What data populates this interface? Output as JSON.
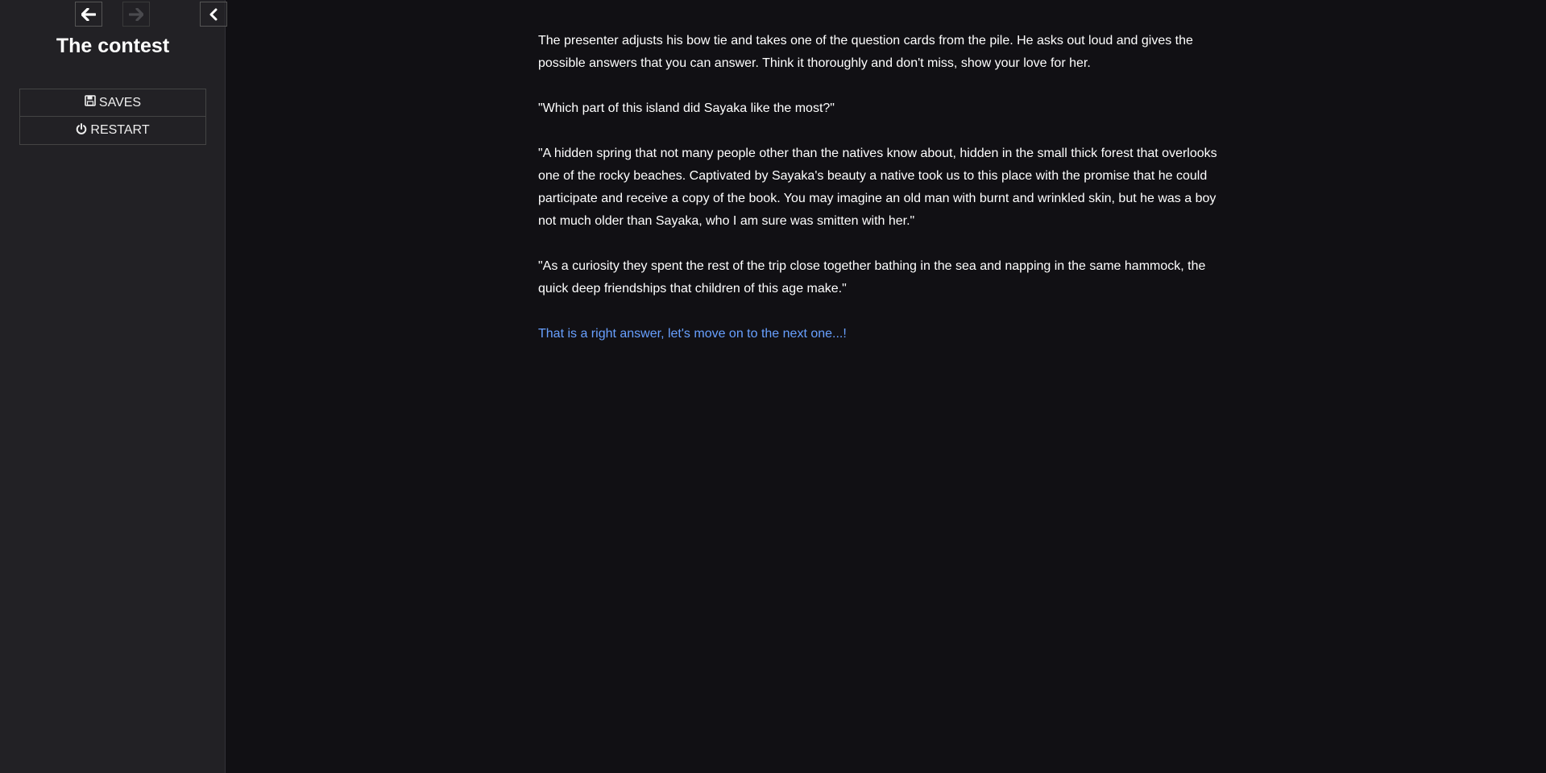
{
  "sidebar": {
    "title": "The contest",
    "menu": {
      "saves_label": "SAVES",
      "restart_label": "RESTART"
    },
    "colors": {
      "background": "#222125",
      "border": "#444444"
    }
  },
  "passage": {
    "paragraphs": [
      "The presenter adjusts his bow tie and takes one of the question cards from the pile. He asks out loud and gives the possible answers that you can answer. Think it thoroughly and don't miss, show your love for her.",
      "\"Which part of this island did Sayaka like the most?\"",
      "\"A hidden spring that not many people other than the natives know about, hidden in the small thick forest that overlooks one of the rocky beaches. Captivated by Sayaka's beauty a native took us to this place with the promise that he could participate and receive a copy of the book. You may imagine an old man with burnt and wrinkled skin, but he was a boy not much older than Sayaka, who I am sure was smitten with her.\"",
      "\"As a curiosity they spent the rest of the trip close together bathing in the sea and napping in the same hammock, the quick deep friendships that children of this age make.\""
    ],
    "link_text": "That is a right answer, let's move on to the next one...!",
    "colors": {
      "text": "#ffffff",
      "link": "#68a0ff",
      "background": "#111014"
    }
  },
  "icons": {
    "back": "arrow-left-icon",
    "forward": "arrow-right-icon",
    "toggle": "chevron-left-icon",
    "saves": "floppy-disk-icon",
    "restart": "power-icon"
  }
}
